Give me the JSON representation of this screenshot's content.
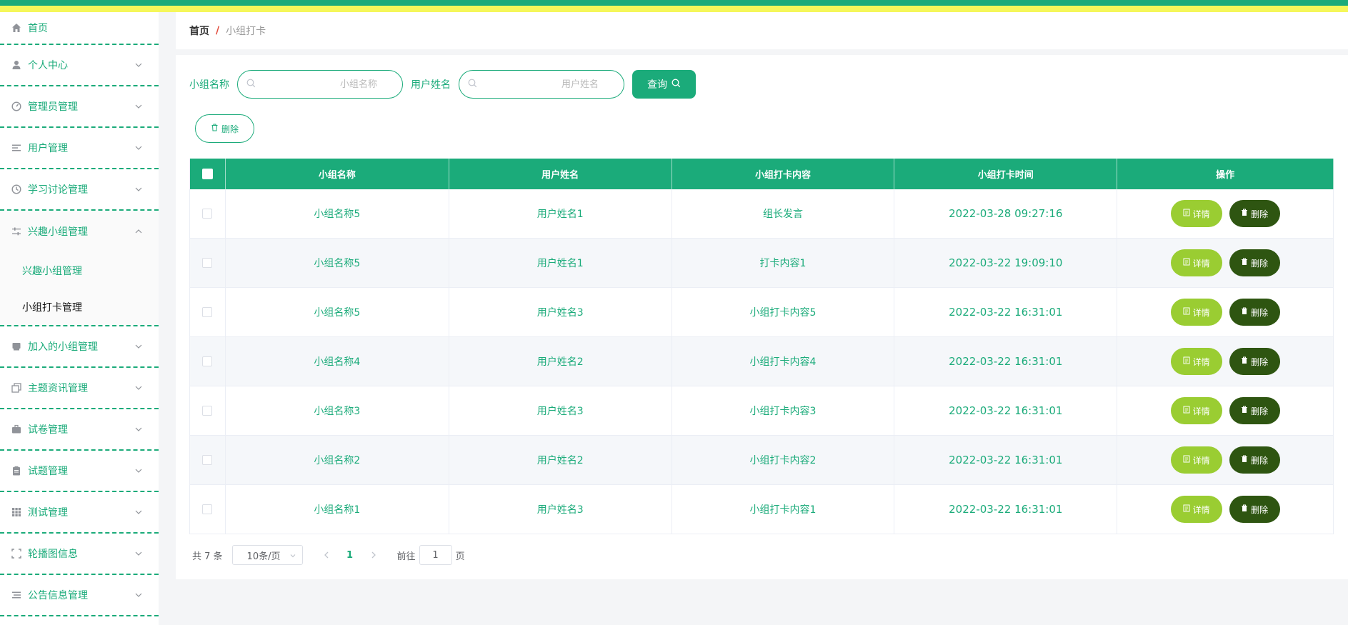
{
  "colors": {
    "primary": "#1bab7a",
    "accent_yellow": "#f5f75a",
    "detail_btn": "#9acd32",
    "delete_btn": "#2e5511"
  },
  "sidebar": {
    "items": [
      {
        "label": "首页",
        "icon": "home-icon"
      },
      {
        "label": "个人中心",
        "icon": "user-icon"
      },
      {
        "label": "管理员管理",
        "icon": "dashboard-icon"
      },
      {
        "label": "用户管理",
        "icon": "list-icon"
      },
      {
        "label": "学习讨论管理",
        "icon": "clock-icon"
      },
      {
        "label": "兴趣小组管理",
        "icon": "sliders-icon"
      },
      {
        "label": "加入的小组管理",
        "icon": "box-icon"
      },
      {
        "label": "主题资讯管理",
        "icon": "copy-icon"
      },
      {
        "label": "试卷管理",
        "icon": "briefcase-icon"
      },
      {
        "label": "试题管理",
        "icon": "clipboard-icon"
      },
      {
        "label": "测试管理",
        "icon": "grid-icon"
      },
      {
        "label": "轮播图信息",
        "icon": "frame-icon"
      },
      {
        "label": "公告信息管理",
        "icon": "list-icon"
      }
    ],
    "submenu": [
      {
        "label": "兴趣小组管理"
      },
      {
        "label": "小组打卡管理"
      }
    ]
  },
  "breadcrumb": {
    "home": "首页",
    "separator": "/",
    "current": "小组打卡"
  },
  "search": {
    "group_label": "小组名称",
    "group_placeholder": "小组名称",
    "user_label": "用户姓名",
    "user_placeholder": "用户姓名",
    "query_label": "查询"
  },
  "toolbar": {
    "delete_label": "删除"
  },
  "table": {
    "headers": [
      "小组名称",
      "用户姓名",
      "小组打卡内容",
      "小组打卡时间",
      "操作"
    ],
    "rows": [
      {
        "group": "小组名称5",
        "user": "用户姓名1",
        "content": "组长发言",
        "time": "2022-03-28 09:27:16"
      },
      {
        "group": "小组名称5",
        "user": "用户姓名1",
        "content": "打卡内容1",
        "time": "2022-03-22 19:09:10"
      },
      {
        "group": "小组名称5",
        "user": "用户姓名3",
        "content": "小组打卡内容5",
        "time": "2022-03-22 16:31:01"
      },
      {
        "group": "小组名称4",
        "user": "用户姓名2",
        "content": "小组打卡内容4",
        "time": "2022-03-22 16:31:01"
      },
      {
        "group": "小组名称3",
        "user": "用户姓名3",
        "content": "小组打卡内容3",
        "time": "2022-03-22 16:31:01"
      },
      {
        "group": "小组名称2",
        "user": "用户姓名2",
        "content": "小组打卡内容2",
        "time": "2022-03-22 16:31:01"
      },
      {
        "group": "小组名称1",
        "user": "用户姓名3",
        "content": "小组打卡内容1",
        "time": "2022-03-22 16:31:01"
      }
    ],
    "detail_label": "详情",
    "delete_label": "删除"
  },
  "pagination": {
    "total": "共 7 条",
    "page_size": "10条/页",
    "current_page": "1",
    "goto_prefix": "前往",
    "goto_value": "1",
    "goto_suffix": "页"
  }
}
